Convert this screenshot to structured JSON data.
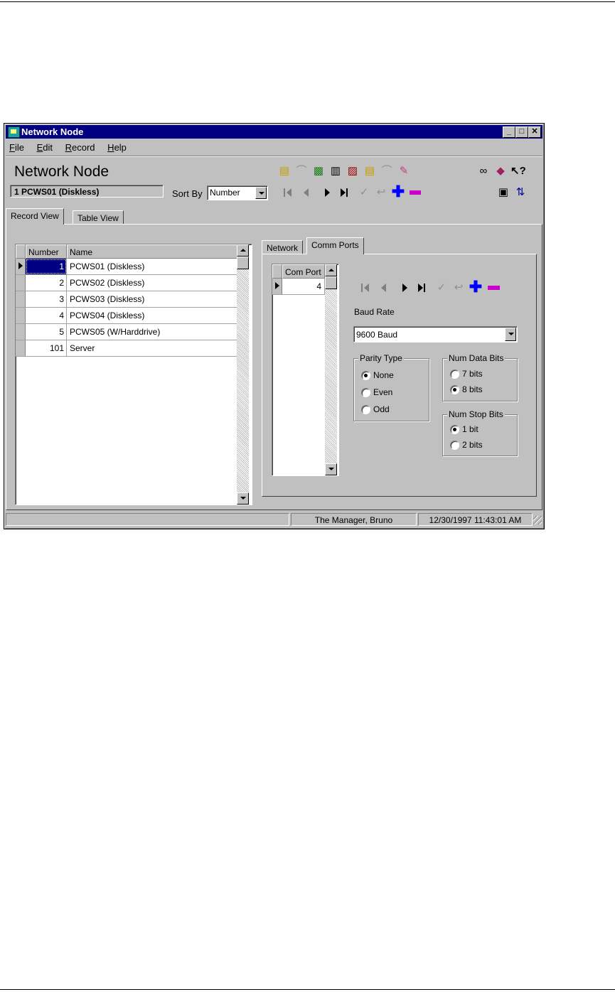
{
  "window": {
    "title": "Network Node"
  },
  "menu": [
    {
      "key": "F",
      "rest": "ile"
    },
    {
      "key": "E",
      "rest": "dit"
    },
    {
      "key": "R",
      "rest": "ecord"
    },
    {
      "key": "H",
      "rest": "elp"
    }
  ],
  "header": {
    "title": "Network Node",
    "current_record": "1 PCWS01 (Diskless)",
    "sort_by_label": "Sort By",
    "sort_by_value": "Number"
  },
  "tabs": {
    "record_view": "Record View",
    "table_view": "Table View"
  },
  "node_grid": {
    "col_number": "Number",
    "col_name": "Name",
    "rows": [
      {
        "number": "1",
        "name": "PCWS01 (Diskless)"
      },
      {
        "number": "2",
        "name": "PCWS02 (Diskless)"
      },
      {
        "number": "3",
        "name": "PCWS03 (Diskless)"
      },
      {
        "number": "4",
        "name": "PCWS04 (Diskless)"
      },
      {
        "number": "5",
        "name": "PCWS05 (W/Harddrive)"
      },
      {
        "number": "101",
        "name": "Server"
      }
    ]
  },
  "subtabs": {
    "network": "Network",
    "comm_ports": "Comm Ports"
  },
  "comm_grid": {
    "col": "Com Port",
    "rows": [
      {
        "value": "4"
      }
    ]
  },
  "baud": {
    "label": "Baud Rate",
    "value": "9600 Baud"
  },
  "parity": {
    "label": "Parity Type",
    "none": "None",
    "even": "Even",
    "odd": "Odd"
  },
  "data_bits": {
    "label": "Num Data Bits",
    "seven": "7 bits",
    "eight": "8 bits"
  },
  "stop_bits": {
    "label": "Num Stop Bits",
    "one": "1 bit",
    "two": "2 bits"
  },
  "status": {
    "user": "The Manager, Bruno",
    "datetime": "12/30/1997 11:43:01 AM"
  },
  "colors": {
    "titlebar": "#000080",
    "face": "#c0c0c0",
    "selection": "#000080",
    "add": "#0000ff",
    "delete": "#cc00cc"
  }
}
